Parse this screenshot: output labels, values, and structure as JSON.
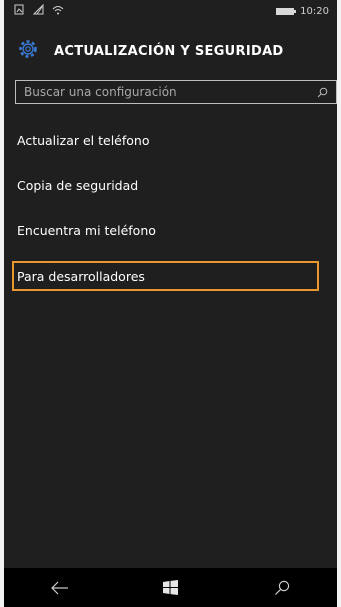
{
  "status_bar": {
    "time": "10:20"
  },
  "header": {
    "title": "ACTUALIZACIÓN Y SEGURIDAD",
    "icon": "gear-icon",
    "accent_color": "#3a7bd5"
  },
  "search": {
    "placeholder": "Buscar una configuración"
  },
  "menu": {
    "items": [
      {
        "label": "Actualizar el teléfono"
      },
      {
        "label": "Copia de seguridad"
      },
      {
        "label": "Encuentra mi teléfono"
      },
      {
        "label": "Para desarrolladores",
        "selected": true
      }
    ],
    "selection_color": "#e8982c"
  },
  "nav_bar": {
    "icons": [
      "back-arrow-icon",
      "windows-logo-icon",
      "search-icon"
    ]
  }
}
